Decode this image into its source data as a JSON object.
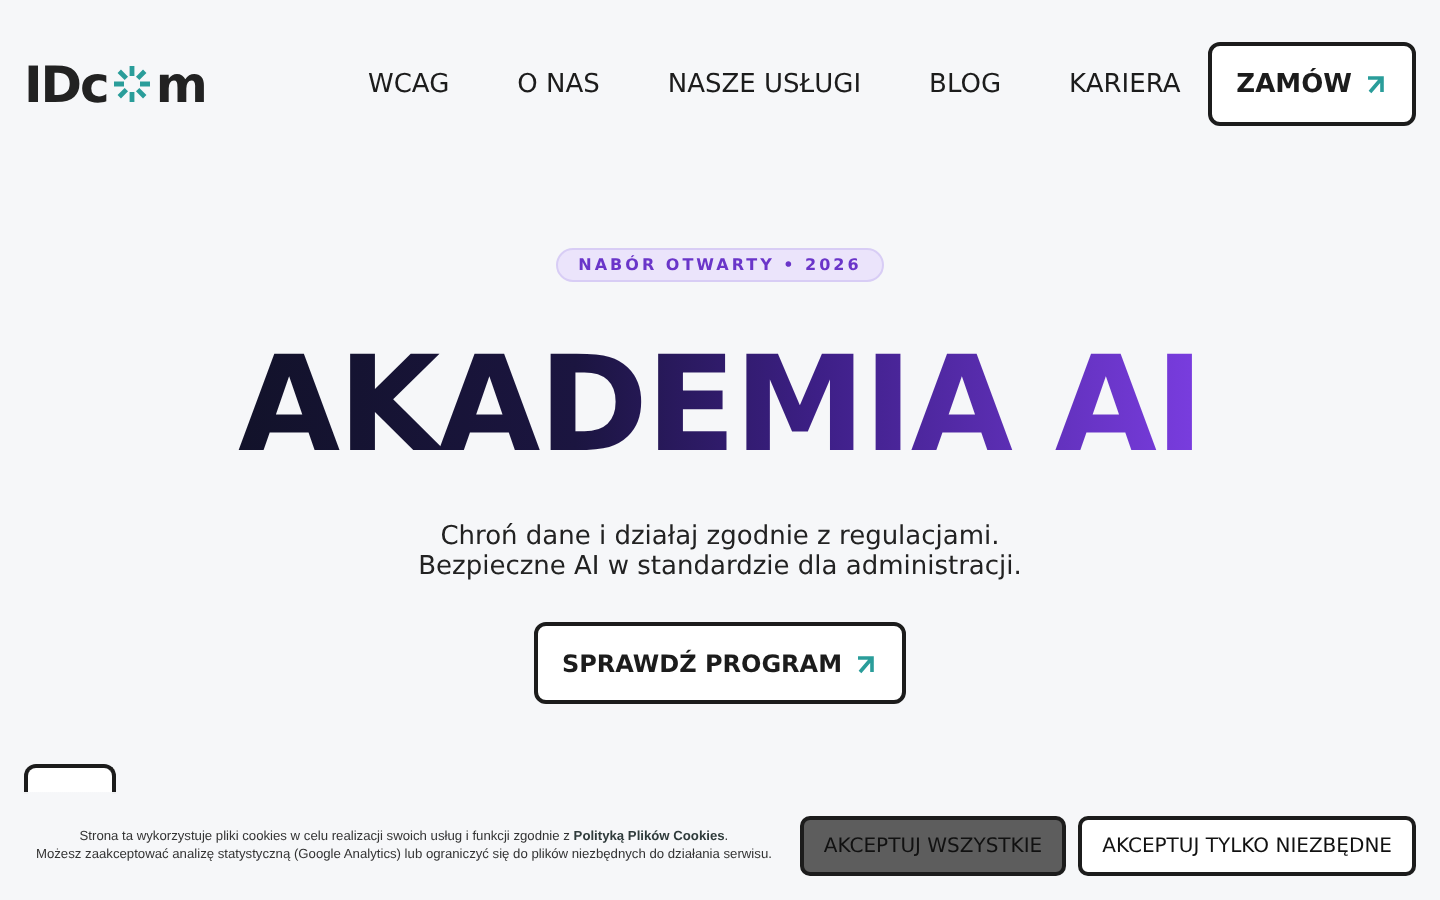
{
  "header": {
    "logo": {
      "before": "IDc",
      "after": "m"
    },
    "nav": [
      "WCAG",
      "O NAS",
      "NASZE USŁUGI",
      "BLOG",
      "KARIERA"
    ],
    "cta": {
      "label": "ZAMÓW"
    }
  },
  "hero": {
    "badge": "NABÓR OTWARTY • 2026",
    "title": "AKADEMIA AI",
    "subtitle": [
      "Chroń dane i działaj zgodnie z regulacjami.",
      "Bezpieczne AI w standardzie dla administracji."
    ],
    "button": {
      "label": "SPRAWDŹ PROGRAM"
    }
  },
  "cookie_banner": {
    "text": "Strona ta wykorzystuje pliki cookies w celu realizacji swoich usług i funkcji zgodnie z",
    "link": "Polityką Plików Cookies",
    "after_link": ".",
    "text2": "Możesz zaakceptować analizę statystyczną (Google Analytics) lub ograniczyć się do plików niezbędnych do działania serwisu.",
    "buttons": [
      {
        "label": "AKCEPTUJ WSZYSTKIE",
        "kind": "primary"
      },
      {
        "label": "AKCEPTUJ TYLKO NIEZBĘDNE",
        "kind": "secondary"
      }
    ]
  }
}
